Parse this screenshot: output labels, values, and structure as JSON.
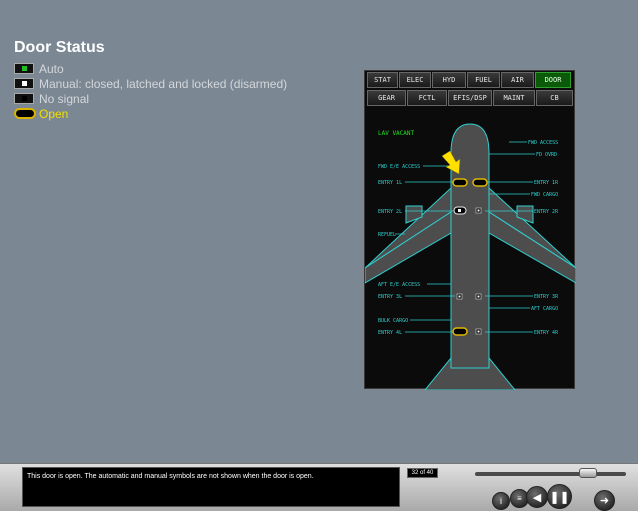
{
  "title": "Door Status",
  "legend": [
    {
      "label": "Auto",
      "icon": "auto-symbol-icon",
      "color": "#21c021"
    },
    {
      "label": "Manual: closed, latched and locked (disarmed)",
      "icon": "manual-symbol-icon",
      "color": "#ffffff"
    },
    {
      "label": "No signal",
      "icon": "no-signal-symbol-icon",
      "color": "#000000"
    },
    {
      "label": "Open",
      "icon": "open-door-symbol-icon",
      "color": "#e0b800"
    }
  ],
  "ecam": {
    "pages_row1": [
      "STAT",
      "ELEC",
      "HYD",
      "FUEL",
      "AIR",
      "DOOR"
    ],
    "pages_row2": [
      "GEAR",
      "FCTL",
      "EFIS/DSP",
      "MAINT",
      "CB"
    ],
    "active_page": "DOOR",
    "labels": {
      "lav_vacant": "LAV VACANT",
      "fwd_access": "FWD ACCESS",
      "fd_ovrd": "FD OVRD",
      "fwd_ee_access": "FWD E/E ACCESS",
      "entry_1l": "ENTRY 1L",
      "entry_1r": "ENTRY 1R",
      "fwd_cargo": "FWD CARGO",
      "entry_2l": "ENTRY 2L",
      "entry_2r": "ENTRY 2R",
      "refuel": "REFUEL",
      "aft_ee_access": "AFT E/E ACCESS",
      "entry_3l": "ENTRY 3L",
      "entry_3r": "ENTRY 3R",
      "aft_cargo": "AFT CARGO",
      "bulk_cargo": "BULK CARGO",
      "entry_4l": "ENTRY 4L",
      "entry_4r": "ENTRY 4R"
    },
    "colors": {
      "label": "#2fd0d0",
      "aircraft": "#4d4d4d",
      "open": "#e0b800",
      "arrow": "#ffe000",
      "lav": "#22e022"
    }
  },
  "caption": "This door is open. The automatic and manual symbols are not shown when the door is open.",
  "counter": "32 of 40",
  "slider_position": 0.75,
  "controls": [
    "info-icon",
    "menu-icon",
    "back-icon",
    "pause-icon",
    "forward-icon"
  ]
}
